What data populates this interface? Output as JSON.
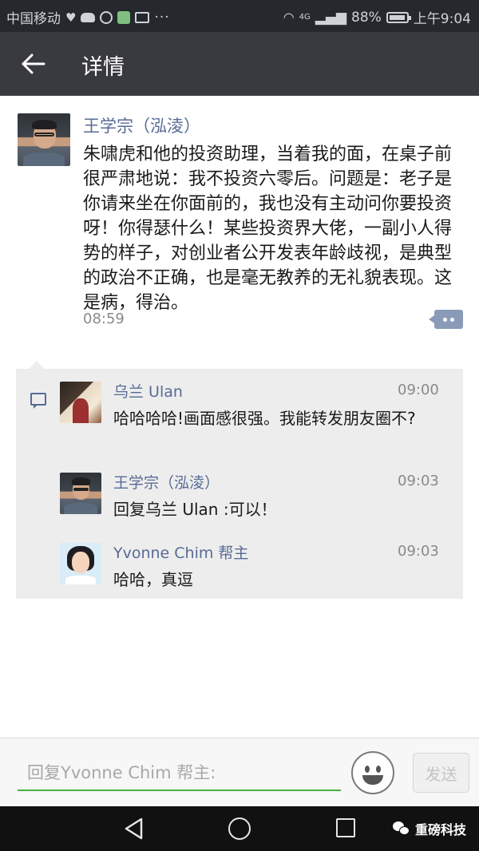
{
  "status_bar": {
    "carrier": "中国移动",
    "network": "4G",
    "battery": "88%",
    "time": "上午9:04",
    "icons": [
      "heart-icon",
      "cloud-icon",
      "q-icon",
      "play-icon",
      "mail-icon",
      "more-dots-icon",
      "wifi-icon",
      "signal-icon",
      "battery-icon"
    ]
  },
  "titlebar": {
    "title": "详情",
    "back_icon": "arrow-left-icon"
  },
  "post": {
    "author": "王学宗（泓淩）",
    "text": "朱啸虎和他的投资助理，当着我的面，在桌子前很严肃地说：我不投资六零后。问题是：老子是你请来坐在你面前的，我也没有主动问你要投资呀！你得瑟什么！某些投资界大佬，一副小人得势的样子，对创业者公开发表年龄歧视，是典型的政治不正确，也是毫无教养的无礼貌表现。这是病，得治。",
    "time": "08:59"
  },
  "comments": [
    {
      "name": "乌兰 Ulan",
      "time": "09:00",
      "text": "哈哈哈哈!画面感很强。我能转发朋友圈不?"
    },
    {
      "name": "王学宗（泓淩）",
      "time": "09:03",
      "text": "回复乌兰 Ulan :可以！"
    },
    {
      "name": "Yvonne Chim 帮主",
      "time": "09:03",
      "text": "哈哈，真逗"
    }
  ],
  "input": {
    "placeholder": "回复Yvonne Chim 帮主:",
    "send_label": "发送"
  },
  "navbar": {
    "watermark": "重磅科技"
  },
  "colors": {
    "name_link": "#576b95",
    "titlebar_bg": "#393a3f",
    "input_accent": "#46b04a"
  }
}
